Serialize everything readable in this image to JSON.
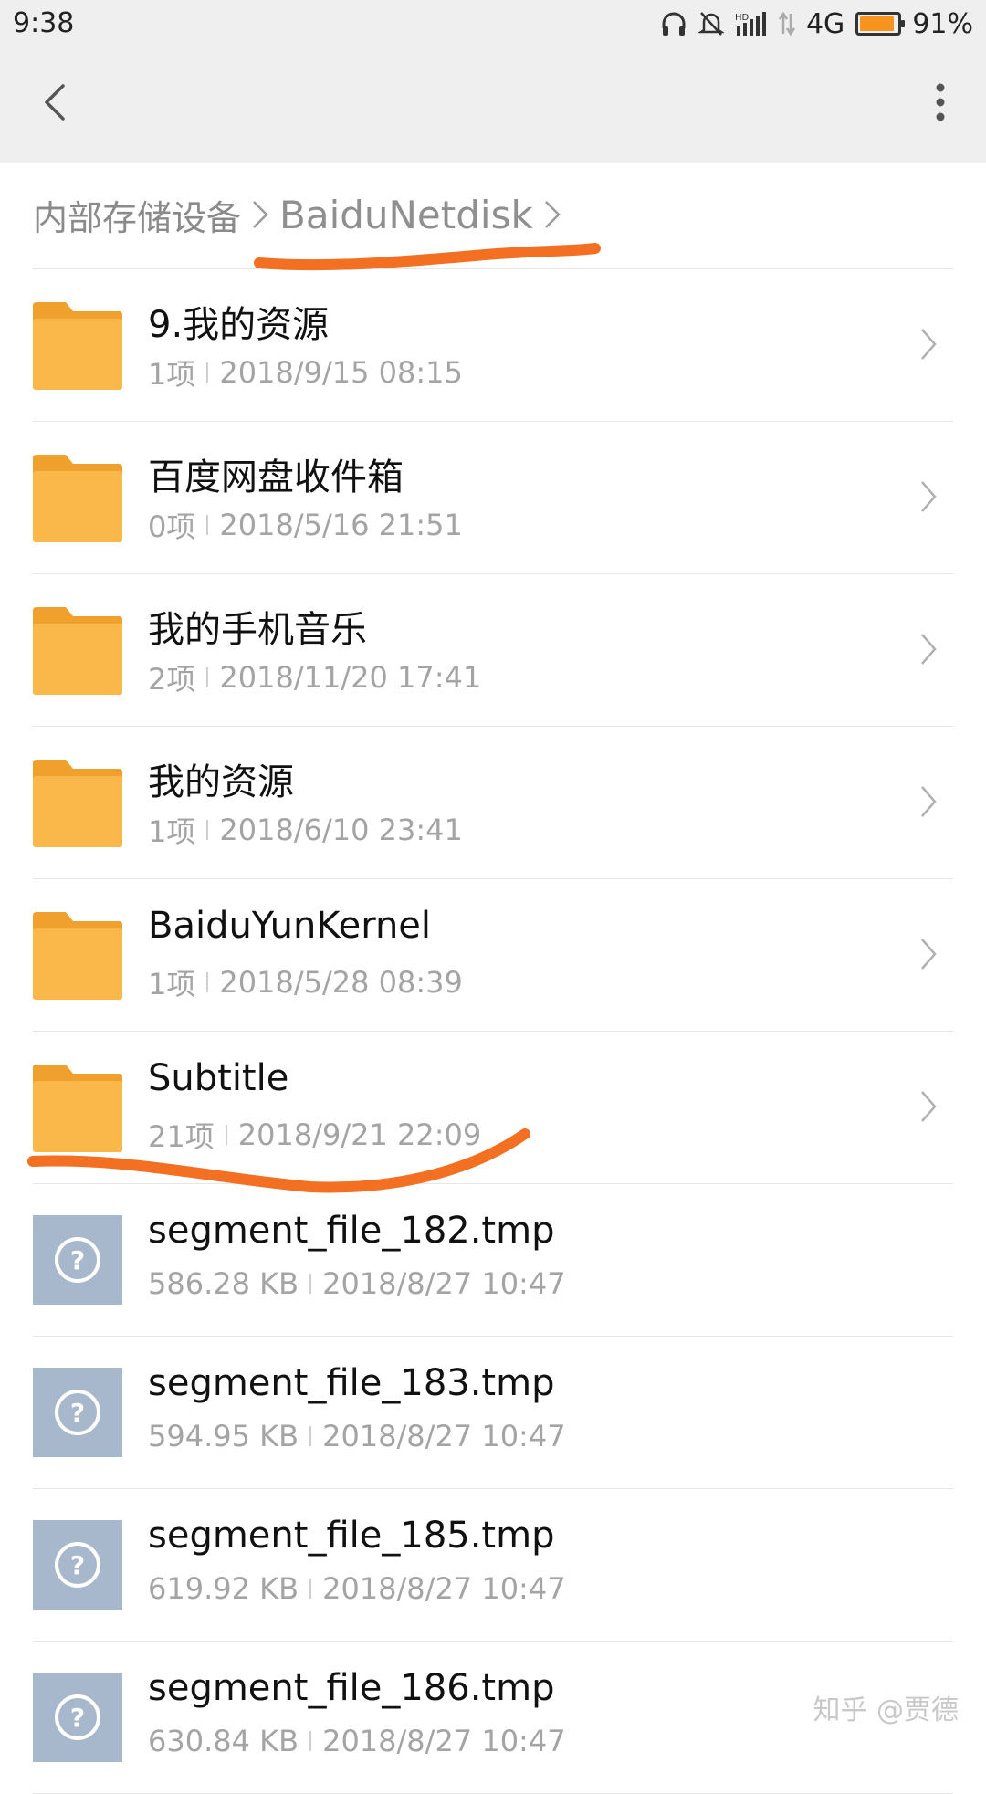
{
  "status_bar": {
    "time": "9:38",
    "network": "4G",
    "battery_percent_text": "91%",
    "battery_level": 0.91,
    "icons": [
      "headphones-icon",
      "mute-bell-icon",
      "hd-signal-icon",
      "signal-icon",
      "data-arrows-icon",
      "battery-icon"
    ]
  },
  "app_bar": {
    "back_icon": "back-arrow-icon",
    "more_icon": "more-vertical-icon"
  },
  "breadcrumb": {
    "items": [
      "内部存储设备",
      "BaiduNetdisk"
    ]
  },
  "files": [
    {
      "name": "9.我的资源",
      "count": "1项",
      "date": "2018/9/15 08:15",
      "type": "folder"
    },
    {
      "name": "百度网盘收件箱",
      "count": "0项",
      "date": "2018/5/16 21:51",
      "type": "folder"
    },
    {
      "name": "我的手机音乐",
      "count": "2项",
      "date": "2018/11/20 17:41",
      "type": "folder"
    },
    {
      "name": "我的资源",
      "count": "1项",
      "date": "2018/6/10 23:41",
      "type": "folder"
    },
    {
      "name": "BaiduYunKernel",
      "count": "1项",
      "date": "2018/5/28 08:39",
      "type": "folder"
    },
    {
      "name": "Subtitle",
      "count": "21项",
      "date": "2018/9/21 22:09",
      "type": "folder"
    },
    {
      "name": "segment_file_182.tmp",
      "size": "586.28 KB",
      "date": "2018/8/27 10:47",
      "type": "unknown"
    },
    {
      "name": "segment_file_183.tmp",
      "size": "594.95 KB",
      "date": "2018/8/27 10:47",
      "type": "unknown"
    },
    {
      "name": "segment_file_185.tmp",
      "size": "619.92 KB",
      "date": "2018/8/27 10:47",
      "type": "unknown"
    },
    {
      "name": "segment_file_186.tmp",
      "size": "630.84 KB",
      "date": "2018/8/27 10:47",
      "type": "unknown"
    }
  ],
  "watermark": "知乎 @贾德",
  "colors": {
    "folder": "#fbb84a",
    "folder_tab": "#f0a02c",
    "unknown_file": "#a8b8cc",
    "annotation": "#f36f21",
    "battery_fill": "#f7941d"
  }
}
